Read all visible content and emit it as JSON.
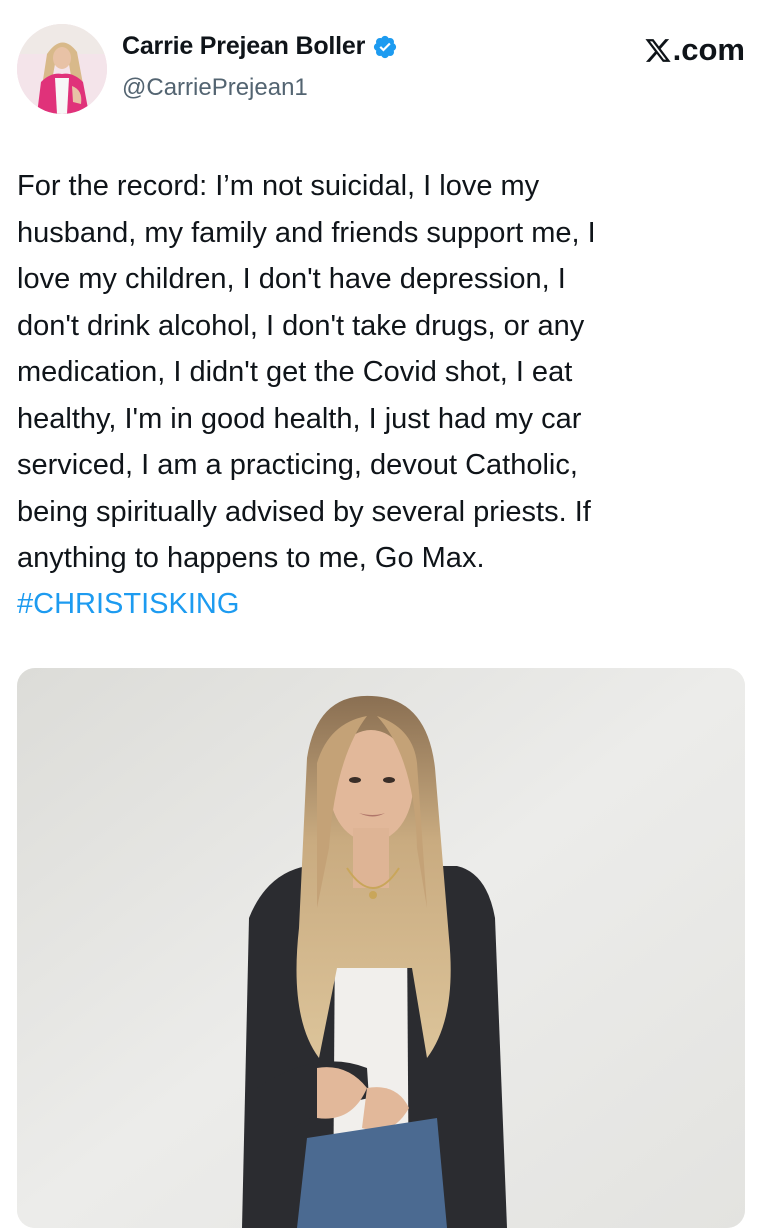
{
  "header": {
    "display_name": "Carrie Prejean Boller",
    "handle": "@CarriePrejean1",
    "site": ".com",
    "verified_color": "#1d9bf0",
    "icons": {
      "verified": "verified-badge-icon",
      "brand": "x-logo-icon"
    }
  },
  "tweet": {
    "text": "For the record: I’m not suicidal, I love my\nhusband, my family and friends support me, I\nlove my children, I don't have depression, I\ndon't drink alcohol, I don't take drugs, or any\nmedication, I didn't get the Covid shot, I eat\nhealthy, I'm in good health, I just had my car\nserviced, I am a practicing, devout Catholic,\nbeing spiritually advised by several priests. If\nanything to happens to me, Go Max.",
    "hashtag": "#CHRISTISKING",
    "hashtag_color": "#1d9bf0"
  }
}
